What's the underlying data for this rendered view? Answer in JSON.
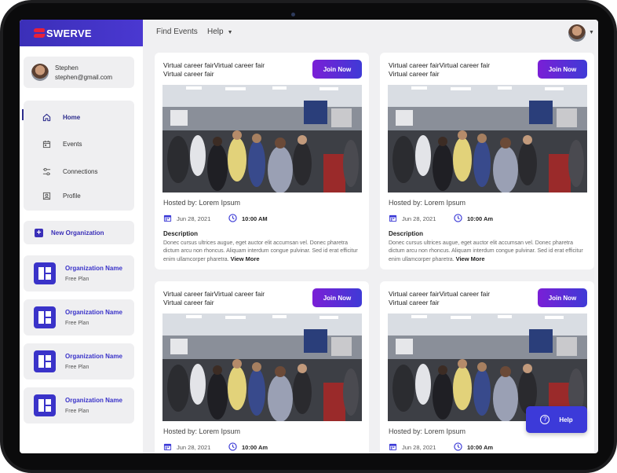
{
  "brand": {
    "name": "SWERVE",
    "accent": "#3b2fb8",
    "logo_color": "#e8203a"
  },
  "user": {
    "name": "Stephen",
    "email": "stephen@gmail.com"
  },
  "topbar": {
    "find_events": "Find Events",
    "help": "Help"
  },
  "sidebar": {
    "nav": [
      {
        "label": "Home",
        "icon": "home-icon",
        "active": true
      },
      {
        "label": "Events",
        "icon": "calendar-icon",
        "active": false
      },
      {
        "label": "Connections",
        "icon": "connections-icon",
        "active": false
      },
      {
        "label": "Profile",
        "icon": "profile-icon",
        "active": false
      }
    ],
    "new_org": "New Organization",
    "orgs": [
      {
        "name": "Organization Name",
        "plan": "Free Plan"
      },
      {
        "name": "Organization Name",
        "plan": "Free Plan"
      },
      {
        "name": "Organization Name",
        "plan": "Free Plan"
      },
      {
        "name": "Organization Name",
        "plan": "Free Plan"
      }
    ]
  },
  "events": [
    {
      "title": "Virtual career fairVirtual career fair Virtual career fair",
      "join": "Join Now",
      "host": "Hosted by: Lorem Ipsum",
      "date": "Jun 28, 2021",
      "time": "10:00 AM",
      "desc_heading": "Description",
      "desc": "Donec cursus ultrices augue, eget auctor elit accumsan vel. Donec pharetra dictum arcu non rhoncus. Aliquam interdum congue pulvinar. Sed id erat efficitur enim ullamcorper pharetra.",
      "view_more": "View More"
    },
    {
      "title": "Virtual career fairVirtual career fair Virtual career fair",
      "join": "Join Now",
      "host": "Hosted by: Lorem Ipsum",
      "date": "Jun 28, 2021",
      "time": "10:00 Am",
      "desc_heading": "Description",
      "desc": "Donec cursus ultrices augue, eget auctor elit accumsan vel. Donec pharetra dictum arcu non rhoncus. Aliquam interdum congue pulvinar. Sed id erat efficitur enim ullamcorper pharetra.",
      "view_more": "View More"
    },
    {
      "title": "Virtual career fairVirtual career fair Virtual career fair",
      "join": "Join Now",
      "host": "Hosted by: Lorem Ipsum",
      "date": "Jun 28, 2021",
      "time": "10:00 Am"
    },
    {
      "title": "Virtual career fairVirtual career fair Virtual career fair",
      "join": "Join Now",
      "host": "Hosted by: Lorem Ipsum",
      "date": "Jun 28, 2021",
      "time": "10:00 Am"
    }
  ],
  "help_button": {
    "label": "Help"
  }
}
